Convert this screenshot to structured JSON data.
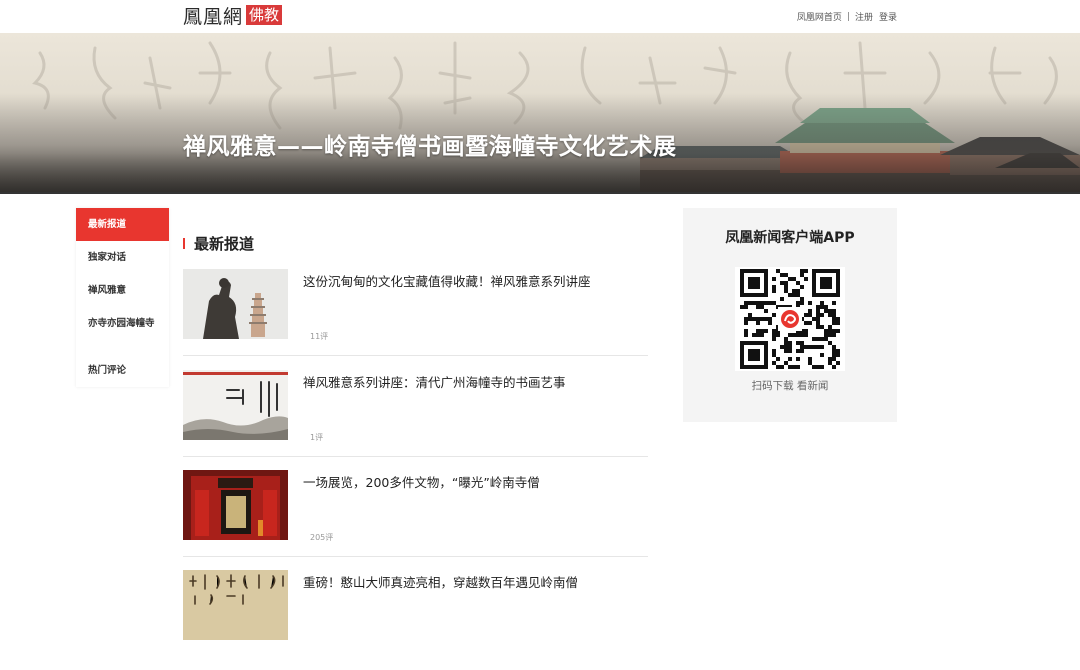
{
  "header": {
    "logo_text": "鳳凰網",
    "logo_tag": "佛教",
    "links": [
      "凤凰网首页",
      "注册",
      "登录"
    ],
    "separator": "|"
  },
  "banner": {
    "title": "禅风雅意——岭南寺僧书画暨海幢寺文化艺术展"
  },
  "sidenav": {
    "items": [
      {
        "label": "最新报道",
        "active": true
      },
      {
        "label": "独家对话",
        "active": false
      },
      {
        "label": "禅风雅意",
        "active": false
      },
      {
        "label": "亦寺亦园海幢寺",
        "active": false
      },
      {
        "label": "热门评论",
        "active": false
      }
    ]
  },
  "main": {
    "section_title": "最新报道",
    "news": [
      {
        "title": "这份沉甸甸的文化宝藏值得收藏！禅风雅意系列讲座",
        "comments": "11评",
        "thumb": "statue-pagoda"
      },
      {
        "title": "禅风雅意系列讲座：清代广州海幢寺的书画艺事",
        "comments": "1评",
        "thumb": "calligraphy-poster"
      },
      {
        "title": "一场展览，200多件文物，“曝光”岭南寺僧",
        "comments": "205评",
        "thumb": "red-exhibition-hall"
      },
      {
        "title": "重磅！憨山大师真迹亮相，穿越数百年遇见岭南僧",
        "comments": "",
        "thumb": "calligraphy-scroll"
      }
    ]
  },
  "app": {
    "title": "凤凰新闻客户端APP",
    "subtitle": "扫码下载 看新闻",
    "qr_icon": "phoenix-logo-icon"
  },
  "colors": {
    "accent": "#e8362f",
    "logo_tag_bg": "#d93a3a"
  }
}
